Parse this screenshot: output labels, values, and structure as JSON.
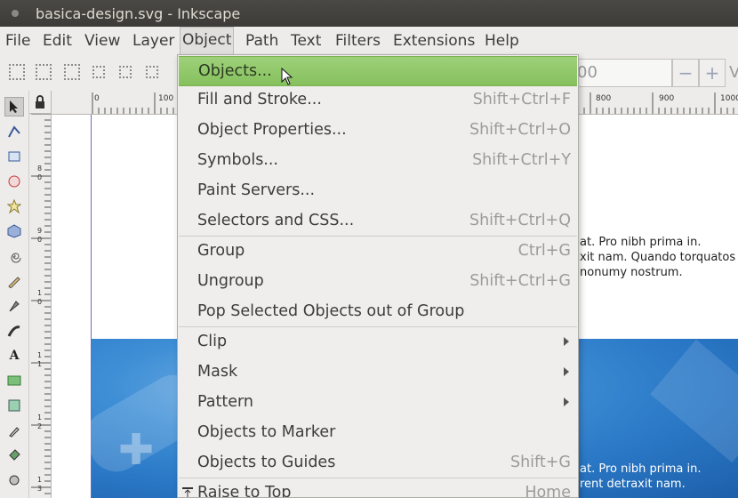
{
  "window": {
    "title": "basica-design.svg - Inkscape"
  },
  "menubar": {
    "items": [
      "File",
      "Edit",
      "View",
      "Layer",
      "Object",
      "Path",
      "Text",
      "Filters",
      "Extensions",
      "Help"
    ],
    "active": "Object"
  },
  "toolbar": {
    "spin_value": "00",
    "minus": "−",
    "plus": "+",
    "cut_label": "V"
  },
  "ruler": {
    "h_ticks": [
      "0",
      "100",
      "800",
      "900",
      "1000"
    ],
    "v_ticks": [
      "8",
      "0",
      "9",
      "0",
      "1",
      "0",
      "1",
      "1",
      "1",
      "2",
      "1",
      "3"
    ]
  },
  "canvas": {
    "text_upper": [
      "at. Pro nibh prima in.",
      "xit nam. Quando torquatos",
      "nonumy nostrum."
    ],
    "text_lower": [
      "at. Pro nibh prima in.",
      "rent detraxit nam."
    ]
  },
  "object_menu": {
    "items": [
      {
        "label": "Objects...",
        "shortcut": "",
        "highlighted": true
      },
      {
        "label": "Fill and Stroke...",
        "shortcut": "Shift+Ctrl+F"
      },
      {
        "label": "Object Properties...",
        "shortcut": "Shift+Ctrl+O"
      },
      {
        "label": "Symbols...",
        "shortcut": "Shift+Ctrl+Y"
      },
      {
        "label": "Paint Servers...",
        "shortcut": ""
      },
      {
        "label": "Selectors and CSS...",
        "shortcut": "Shift+Ctrl+Q"
      },
      {
        "label": "Group",
        "shortcut": "Ctrl+G"
      },
      {
        "label": "Ungroup",
        "shortcut": "Shift+Ctrl+G"
      },
      {
        "label": "Pop Selected Objects out of Group",
        "shortcut": ""
      },
      {
        "label": "Clip",
        "shortcut": "",
        "submenu": true
      },
      {
        "label": "Mask",
        "shortcut": "",
        "submenu": true
      },
      {
        "label": "Pattern",
        "shortcut": "",
        "submenu": true
      },
      {
        "label": "Objects to Marker",
        "shortcut": ""
      },
      {
        "label": "Objects to Guides",
        "shortcut": "Shift+G"
      },
      {
        "label": "Raise to Top",
        "shortcut": "Home"
      }
    ]
  },
  "colors": {
    "highlight": "#8cc563",
    "titlebar": "#3c3b37",
    "menu_bg": "#efeeec",
    "photo_blue": "#2a78c6"
  }
}
